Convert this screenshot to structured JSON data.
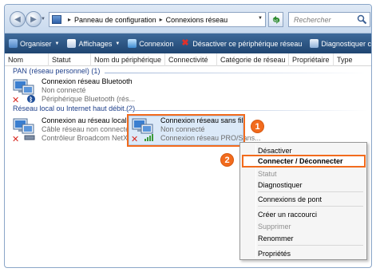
{
  "address": {
    "crumbs": [
      "Panneau de configuration",
      "Connexions réseau"
    ],
    "search_placeholder": "Rechercher"
  },
  "toolbar": {
    "items": [
      {
        "label": "Organiser",
        "has_caret": true
      },
      {
        "label": "Affichages",
        "has_caret": true
      },
      {
        "label": "Connexion",
        "has_caret": false
      },
      {
        "label": "Désactiver ce périphérique réseau",
        "has_caret": false
      },
      {
        "label": "Diagnostiquer cette connexion",
        "has_caret": false
      }
    ]
  },
  "columns": [
    "Nom",
    "Statut",
    "Nom du périphérique",
    "Connectivité",
    "Catégorie de réseau",
    "Propriétaire",
    "Type"
  ],
  "groups": [
    {
      "title": "PAN (réseau personnel) (1)",
      "items": [
        {
          "name": "Connexion réseau Bluetooth",
          "status": "Non connecté",
          "device": "Périphérique Bluetooth (rés..."
        }
      ]
    },
    {
      "title": "Réseau local ou Internet haut débit (2)",
      "items": [
        {
          "name": "Connexion au réseau local",
          "status": "Câble réseau non connecté",
          "device": "Contrôleur Broadcom NetX..."
        },
        {
          "name": "Connexion réseau sans fil",
          "status": "Non connecté",
          "device": "Connexion réseau PRO/Sans..."
        }
      ]
    }
  ],
  "badges": [
    "1",
    "2"
  ],
  "context_menu": {
    "items": [
      {
        "label": "Désactiver",
        "disabled": false,
        "bold": false
      },
      {
        "label": "Connecter / Déconnecter",
        "disabled": false,
        "bold": true
      },
      {
        "label": "Statut",
        "disabled": true,
        "bold": false
      },
      {
        "label": "Diagnostiquer",
        "disabled": false,
        "bold": false
      },
      {
        "label": "Connexions de pont",
        "disabled": false,
        "bold": false
      },
      {
        "label": "Créer un raccourci",
        "disabled": false,
        "bold": false
      },
      {
        "label": "Supprimer",
        "disabled": true,
        "bold": false
      },
      {
        "label": "Renommer",
        "disabled": false,
        "bold": false
      },
      {
        "label": "Propriétés",
        "disabled": false,
        "bold": false
      }
    ]
  },
  "colors": {
    "accent_orange": "#f26b1d",
    "toolbar_blue": "#2c5582",
    "group_title_blue": "#1e3f8a"
  }
}
